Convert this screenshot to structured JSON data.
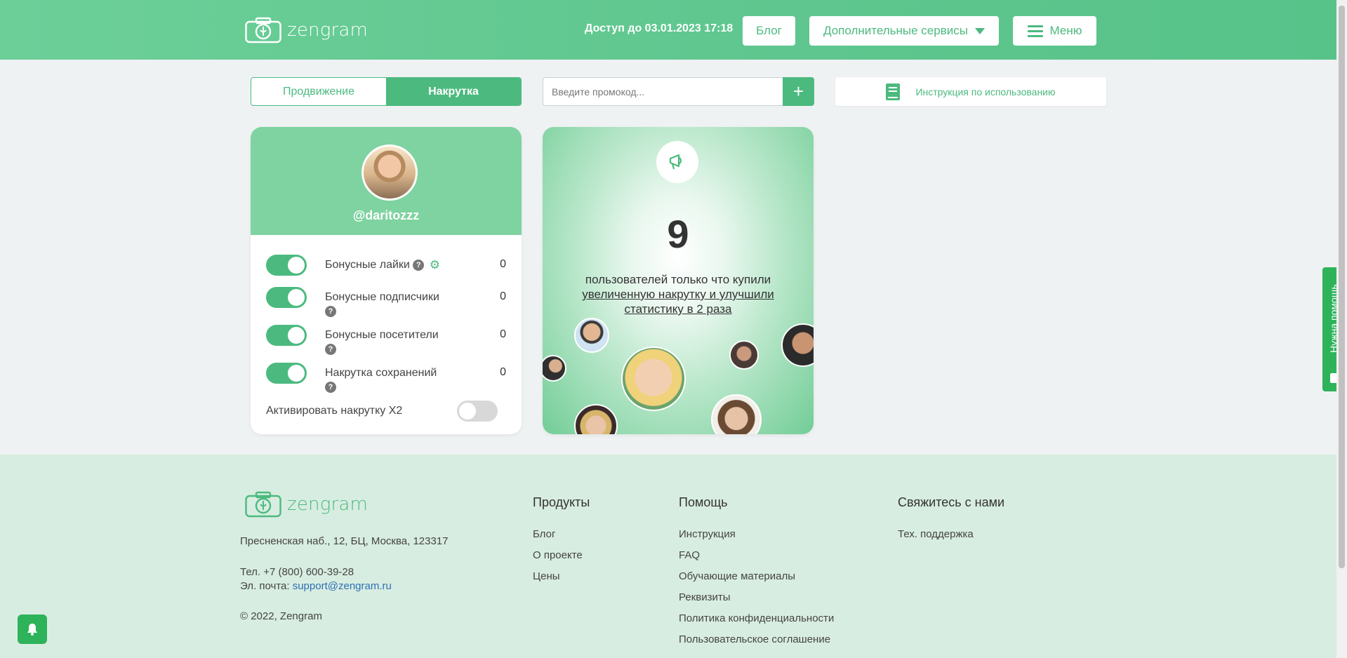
{
  "header": {
    "logo_text": "zengram",
    "access_text": "Доступ до 03.01.2023 17:18",
    "blog_label": "Блог",
    "services_label": "Дополнительные сервисы",
    "menu_label": "Меню"
  },
  "tabs": {
    "promotion": "Продвижение",
    "boost": "Накрутка",
    "active": "Накрутка"
  },
  "promo": {
    "placeholder": "Введите промокод...",
    "add_label": "+"
  },
  "instruction_label": "Инструкция по использованию",
  "profile": {
    "username": "@daritozzz",
    "rows": [
      {
        "label": "Бонусные лайки",
        "value": "0",
        "enabled": true
      },
      {
        "label": "Бонусные подписчики",
        "value": "0",
        "enabled": true
      },
      {
        "label": "Бонусные посетители",
        "value": "0",
        "enabled": true
      },
      {
        "label": "Накрутка сохранений",
        "value": "0",
        "enabled": true
      }
    ],
    "x2_label": "Активировать накрутку X2",
    "x2_enabled": false
  },
  "promo_card": {
    "count": "9",
    "text_plain": "пользователей только что купили",
    "text_link": "увеличенную накрутку и улучшили статистику в 2 раза"
  },
  "footer": {
    "logo_text": "zengram",
    "address": "Пресненская наб., 12, БЦ, Москва, 123317",
    "phone": "Тел. +7 (800) 600-39-28",
    "email_prefix": "Эл. почта:",
    "email": "support@zengram.ru",
    "copyright": "© 2022, Zengram",
    "products": {
      "title": "Продукты",
      "links": [
        "Блог",
        "О проекте",
        "Цены"
      ]
    },
    "help": {
      "title": "Помощь",
      "links": [
        "Инструкция",
        "FAQ",
        "Обучающие материалы",
        "Реквизиты",
        "Политика конфиденциальности",
        "Пользовательское соглашение"
      ]
    },
    "contact": {
      "title": "Свяжитесь с нами",
      "links": [
        "Тех. поддержка"
      ]
    }
  },
  "help_widget_label": "Нужна помощь",
  "colors": {
    "brand": "#4cba7f",
    "header": "#5ec68e",
    "footer": "#d8ede1",
    "help": "#2eb35b"
  }
}
